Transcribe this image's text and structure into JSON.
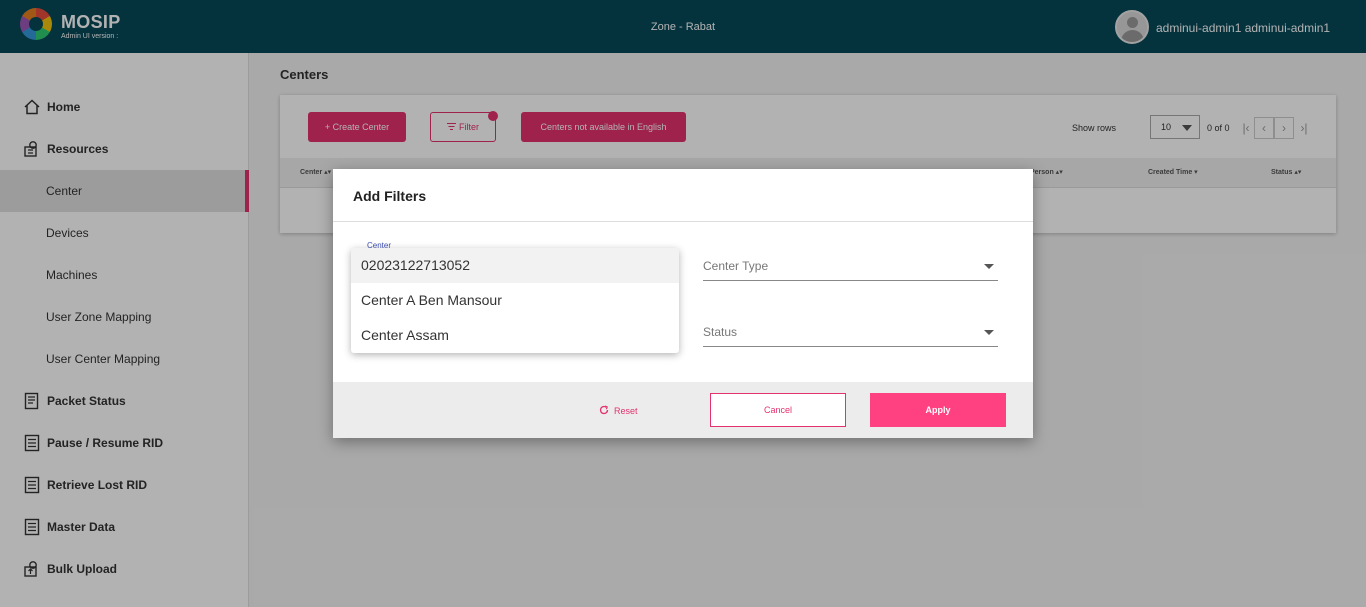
{
  "header": {
    "brand": "MOSIP",
    "version_label": "Admin UI version :",
    "zone": "Zone - Rabat",
    "user": "adminui-admin1 adminui-admin1"
  },
  "sidebar": {
    "items": [
      {
        "label": "Home",
        "icon": "home-icon"
      },
      {
        "label": "Resources",
        "icon": "resources-icon"
      },
      {
        "label": "Center"
      },
      {
        "label": "Devices"
      },
      {
        "label": "Machines"
      },
      {
        "label": "User Zone Mapping"
      },
      {
        "label": "User Center Mapping"
      },
      {
        "label": "Packet Status",
        "icon": "packet-icon"
      },
      {
        "label": "Pause / Resume RID",
        "icon": "list-icon"
      },
      {
        "label": "Retrieve Lost RID",
        "icon": "list-icon"
      },
      {
        "label": "Master Data",
        "icon": "list-icon"
      },
      {
        "label": "Bulk Upload",
        "icon": "upload-icon"
      }
    ],
    "active": "Center",
    "accent": "#e4316f"
  },
  "main": {
    "title": "Centers",
    "create_label": "+ Create Center",
    "filter_label": "Filter",
    "not_available_label": "Centers not available in English",
    "show_rows_label": "Show rows",
    "rows_value": "10",
    "page_info": "0 of 0",
    "columns": [
      "Center",
      "Person",
      "Created Time",
      "Status"
    ]
  },
  "dialog": {
    "title": "Add Filters",
    "center_label": "Center",
    "center_type_placeholder": "Center Type",
    "status_placeholder": "Status",
    "reset_label": "Reset",
    "cancel_label": "Cancel",
    "apply_label": "Apply",
    "center_options": [
      "02023122713052",
      "Center A Ben Mansour",
      "Center Assam"
    ]
  },
  "colors": {
    "header_bg": "#07495a",
    "accent": "#e4316f",
    "apply": "#ff4081"
  }
}
